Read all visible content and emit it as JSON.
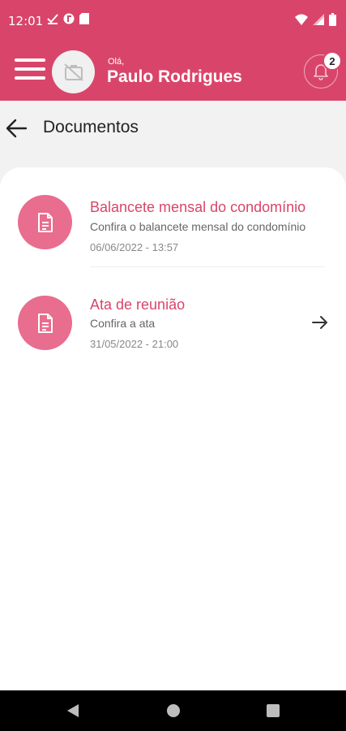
{
  "status_bar": {
    "time": "12:01",
    "left_icons": [
      "check-download-icon",
      "circle-app-icon",
      "sd-card-icon"
    ],
    "right_icons": [
      "wifi-icon",
      "signal-icon",
      "battery-icon"
    ]
  },
  "header": {
    "greeting": "Olá,",
    "user_name": "Paulo Rodrigues",
    "notification_count": "2",
    "brand_color": "#d9456a"
  },
  "page": {
    "title": "Documentos"
  },
  "documents": [
    {
      "title": "Balancete mensal do condomínio",
      "description": "Confira o balancete mensal do condomínio",
      "date": "06/06/2022 - 13:57"
    },
    {
      "title": "Ata de reunião",
      "description": "Confira a ata",
      "date": "31/05/2022 - 21:00"
    }
  ],
  "nav_bar": {
    "buttons": [
      "back-triangle-icon",
      "home-circle-icon",
      "recents-square-icon"
    ]
  }
}
